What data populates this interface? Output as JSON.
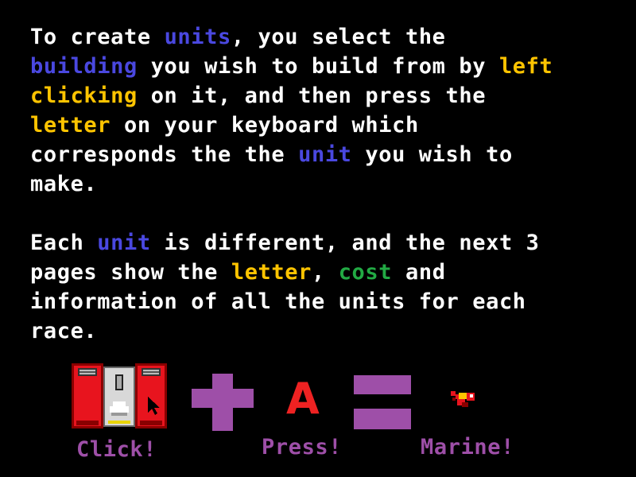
{
  "instructions": {
    "para1_lines": [
      [
        {
          "t": "To create ",
          "c": "white"
        },
        {
          "t": "units",
          "c": "blue"
        },
        {
          "t": ", you select the",
          "c": "white"
        }
      ],
      [
        {
          "t": "building",
          "c": "blue"
        },
        {
          "t": " you wish to build from by ",
          "c": "white"
        },
        {
          "t": "left",
          "c": "yellow"
        }
      ],
      [
        {
          "t": "clicking",
          "c": "yellow"
        },
        {
          "t": " on it, and then press the",
          "c": "white"
        }
      ],
      [
        {
          "t": "letter",
          "c": "yellow"
        },
        {
          "t": " on your keyboard which",
          "c": "white"
        }
      ],
      [
        {
          "t": "corresponds the the ",
          "c": "white"
        },
        {
          "t": "unit",
          "c": "blue"
        },
        {
          "t": " you wish to",
          "c": "white"
        }
      ],
      [
        {
          "t": "make.",
          "c": "white"
        }
      ]
    ],
    "para2_lines": [
      [
        {
          "t": "Each ",
          "c": "white"
        },
        {
          "t": "unit",
          "c": "blue"
        },
        {
          "t": " is different, and the next 3",
          "c": "white"
        }
      ],
      [
        {
          "t": "pages show the ",
          "c": "white"
        },
        {
          "t": "letter",
          "c": "yellow"
        },
        {
          "t": ", ",
          "c": "white"
        },
        {
          "t": "cost",
          "c": "green"
        },
        {
          "t": " and",
          "c": "white"
        }
      ],
      [
        {
          "t": "information of all the units for each",
          "c": "white"
        }
      ],
      [
        {
          "t": "race.",
          "c": "white"
        }
      ]
    ]
  },
  "equation": {
    "building_icon": "barracks-building-icon",
    "plus_icon": "plus-icon",
    "key_letter": "A",
    "equals_icon": "equals-icon",
    "unit_icon": "marine-unit-icon",
    "click_label": "Click!",
    "press_label": "Press!",
    "result_label": "Marine!"
  },
  "colors": {
    "background": "#000000",
    "text": "#ffffff",
    "highlight_blue": "#4a48e0",
    "highlight_yellow": "#ffc400",
    "highlight_green": "#22aa44",
    "symbol_purple": "#9e4fa8",
    "key_red": "#ee2222"
  }
}
